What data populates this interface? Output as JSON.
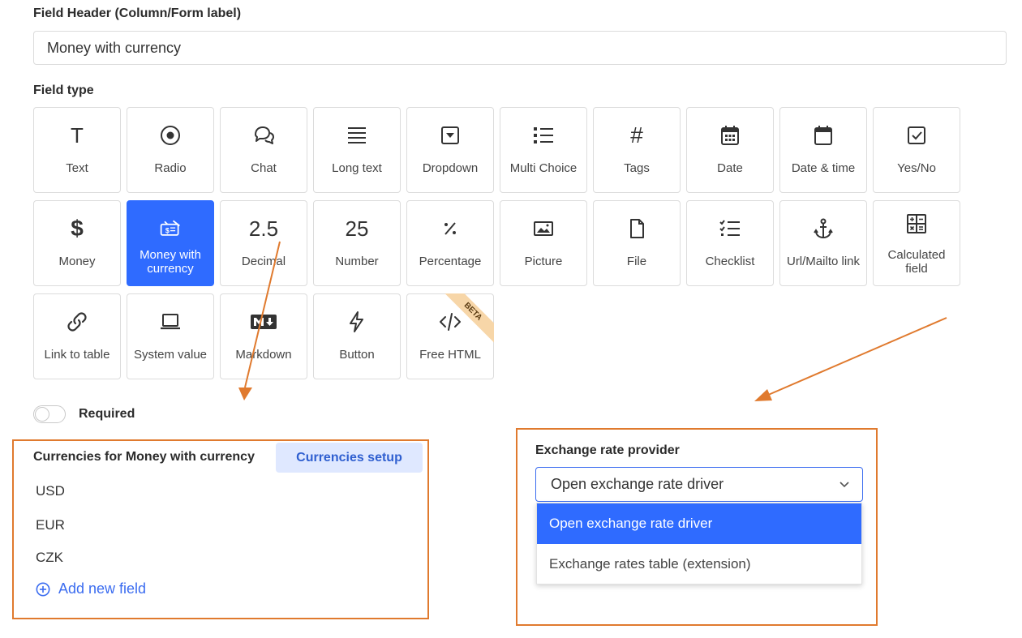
{
  "header_field": {
    "label": "Field Header (Column/Form label)",
    "value": "Money with currency"
  },
  "field_type": {
    "label": "Field type",
    "tiles": [
      {
        "label": "Text",
        "icon": "T"
      },
      {
        "label": "Radio",
        "icon": "radio-icon"
      },
      {
        "label": "Chat",
        "icon": "chat-icon"
      },
      {
        "label": "Long text",
        "icon": "long-text-icon"
      },
      {
        "label": "Dropdown",
        "icon": "dropdown-icon"
      },
      {
        "label": "Multi Choice",
        "icon": "list-icon"
      },
      {
        "label": "Tags",
        "icon": "#"
      },
      {
        "label": "Date",
        "icon": "calendar-icon"
      },
      {
        "label": "Date & time",
        "icon": "calendar-blank-icon"
      },
      {
        "label": "Yes/No",
        "icon": "checkbox-icon"
      },
      {
        "label": "Money",
        "icon": "$"
      },
      {
        "label": "Money with currency",
        "icon": "money-currency-icon",
        "selected": true
      },
      {
        "label": "Decimal",
        "icon": "2.5"
      },
      {
        "label": "Number",
        "icon": "25"
      },
      {
        "label": "Percentage",
        "icon": "percent-icon"
      },
      {
        "label": "Picture",
        "icon": "picture-icon"
      },
      {
        "label": "File",
        "icon": "file-icon"
      },
      {
        "label": "Checklist",
        "icon": "checklist-icon"
      },
      {
        "label": "Url/Mailto link",
        "icon": "anchor-icon"
      },
      {
        "label": "Calculated field",
        "icon": "calculator-icon"
      },
      {
        "label": "Link to table",
        "icon": "link-icon"
      },
      {
        "label": "System value",
        "icon": "laptop-icon"
      },
      {
        "label": "Markdown",
        "icon": "markdown-icon"
      },
      {
        "label": "Button",
        "icon": "lightning-icon"
      },
      {
        "label": "Free HTML",
        "icon": "code-icon",
        "badge": "BETA"
      }
    ]
  },
  "required": {
    "label": "Required",
    "on": false
  },
  "currencies": {
    "title": "Currencies for Money with currency",
    "setup_button": "Currencies setup",
    "items": [
      "USD",
      "EUR",
      "CZK"
    ],
    "add_label": "Add new field"
  },
  "exchange": {
    "label": "Exchange rate provider",
    "selected": "Open exchange rate driver",
    "options": [
      "Open exchange rate driver",
      "Exchange rates table (extension)"
    ]
  },
  "colors": {
    "accent": "#2f6bff",
    "annotation": "#e07a2e"
  }
}
